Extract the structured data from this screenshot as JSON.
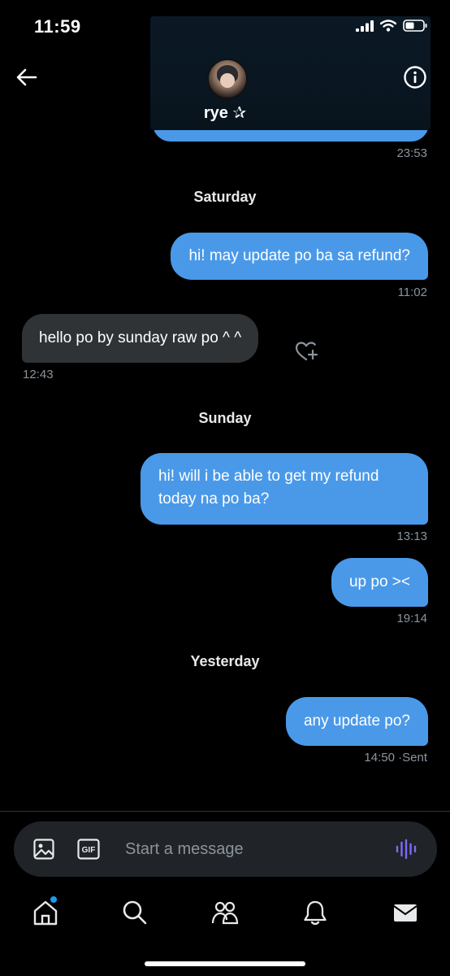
{
  "status_bar": {
    "time": "11:59"
  },
  "header": {
    "name": "rye ✰"
  },
  "messages": [
    {
      "kind": "timestamp",
      "side": "right",
      "text": "23:53"
    },
    {
      "kind": "day",
      "text": "Saturday"
    },
    {
      "kind": "bubble",
      "side": "out",
      "text": "hi! may update po ba sa refund?"
    },
    {
      "kind": "timestamp",
      "side": "right",
      "text": "11:02"
    },
    {
      "kind": "bubble",
      "side": "in",
      "text": "hello po by sunday raw po ^ ^"
    },
    {
      "kind": "timestamp",
      "side": "left",
      "text": "12:43"
    },
    {
      "kind": "day",
      "text": "Sunday"
    },
    {
      "kind": "bubble",
      "side": "out",
      "text": "hi! will i be able to get my refund today na po ba?"
    },
    {
      "kind": "timestamp",
      "side": "right",
      "text": "13:13"
    },
    {
      "kind": "bubble",
      "side": "out",
      "text": "up po ><"
    },
    {
      "kind": "timestamp",
      "side": "right",
      "text": "19:14"
    },
    {
      "kind": "day",
      "text": "Yesterday"
    },
    {
      "kind": "bubble",
      "side": "out",
      "text": "any update po?"
    },
    {
      "kind": "timestamp",
      "side": "right",
      "text": "14:50"
    },
    {
      "kind": "status",
      "text": "Sent"
    }
  ],
  "composer": {
    "placeholder": "Start a message"
  },
  "icons": {
    "back": "arrow-left-icon",
    "info": "info-icon",
    "react": "heart-plus-icon",
    "image": "image-icon",
    "gif": "gif-icon",
    "voice": "voice-wave-icon",
    "nav": [
      "home-icon",
      "search-icon",
      "communities-icon",
      "bell-icon",
      "mail-icon"
    ]
  },
  "colors": {
    "outgoing_bubble": "#4a99e9",
    "incoming_bubble": "#2f3336",
    "accent": "#1d9bf0",
    "voice": "#7b6cf6"
  }
}
